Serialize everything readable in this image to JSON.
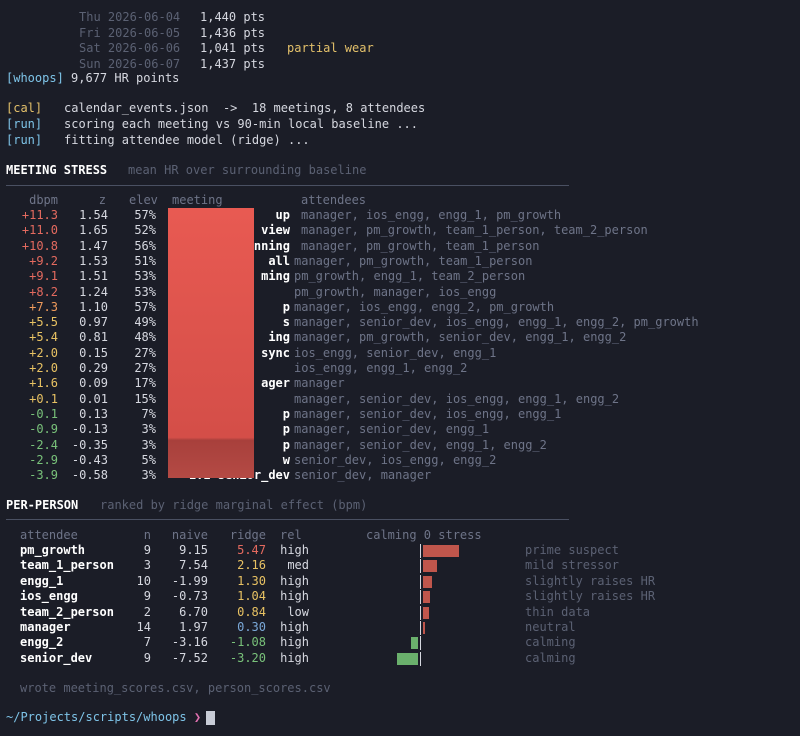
{
  "daily": [
    {
      "day": "Thu 2026-06-04",
      "pts": "1,440 pts",
      "note": ""
    },
    {
      "day": "Fri 2026-06-05",
      "pts": "1,436 pts",
      "note": ""
    },
    {
      "day": "Sat 2026-06-06",
      "pts": "1,041 pts",
      "note": "partial wear"
    },
    {
      "day": "Sun 2026-06-07",
      "pts": "1,437 pts",
      "note": ""
    }
  ],
  "whoops_tag": "[whoops]",
  "whoops_text": "9,677 HR points",
  "log": [
    {
      "tag": "[cal]",
      "text": "calendar_events.json  ->  18 meetings, 8 attendees"
    },
    {
      "tag": "[run]",
      "text": "scoring each meeting vs 90-min local baseline ..."
    },
    {
      "tag": "[run]",
      "text": "fitting attendee model (ridge) ..."
    }
  ],
  "meeting_title": "MEETING STRESS",
  "meeting_sub": "mean HR over surrounding baseline",
  "meeting_headers": {
    "dbpm": "dbpm",
    "z": "z",
    "elev": "elev",
    "meeting": "meeting",
    "attendees": "attendees"
  },
  "meetings": [
    {
      "dbpm": "+11.3",
      "z": "1.54",
      "elev": "57%",
      "name": "up",
      "att": "manager, ios_engg, engg_1, pm_growth",
      "c": "red"
    },
    {
      "dbpm": "+11.0",
      "z": "1.65",
      "elev": "52%",
      "name": "view",
      "att": "manager, pm_growth, team_1_person, team_2_person",
      "c": "red"
    },
    {
      "dbpm": "+10.8",
      "z": "1.47",
      "elev": "56%",
      "name": "nning",
      "att": "manager, pm_growth, team_1_person",
      "c": "red"
    },
    {
      "dbpm": "+9.2",
      "z": "1.53",
      "elev": "51%",
      "name": "all",
      "att": "manager, pm_growth, team_1_person",
      "c": "red"
    },
    {
      "dbpm": "+9.1",
      "z": "1.51",
      "elev": "53%",
      "name": "ming",
      "att": "pm_growth, engg_1, team_2_person",
      "c": "red"
    },
    {
      "dbpm": "+8.2",
      "z": "1.24",
      "elev": "53%",
      "name": "",
      "att": "pm_growth, manager, ios_engg",
      "c": "red"
    },
    {
      "dbpm": "+7.3",
      "z": "1.10",
      "elev": "57%",
      "name": "p",
      "att": "manager, ios_engg, engg_2, pm_growth",
      "c": "orange"
    },
    {
      "dbpm": "+5.5",
      "z": "0.97",
      "elev": "49%",
      "name": "s",
      "att": "manager, senior_dev, ios_engg, engg_1, engg_2, pm_growth",
      "c": "ylw"
    },
    {
      "dbpm": "+5.4",
      "z": "0.81",
      "elev": "48%",
      "name": "ing",
      "att": "manager, pm_growth, senior_dev, engg_1, engg_2",
      "c": "ylw"
    },
    {
      "dbpm": "+2.0",
      "z": "0.15",
      "elev": "27%",
      "name": "sync",
      "att": "ios_engg, senior_dev, engg_1",
      "c": "ylw"
    },
    {
      "dbpm": "+2.0",
      "z": "0.29",
      "elev": "27%",
      "name": "",
      "att": "ios_engg, engg_1, engg_2",
      "c": "ylw"
    },
    {
      "dbpm": "+1.6",
      "z": "0.09",
      "elev": "17%",
      "name": "ager",
      "att": "manager",
      "c": "ylw"
    },
    {
      "dbpm": "+0.1",
      "z": "0.01",
      "elev": "15%",
      "name": "",
      "att": "manager, senior_dev, ios_engg, engg_1, engg_2",
      "c": "ylw"
    },
    {
      "dbpm": "-0.1",
      "z": "0.13",
      "elev": "7%",
      "name": "p",
      "att": "manager, senior_dev, ios_engg, engg_1",
      "c": "green"
    },
    {
      "dbpm": "-0.9",
      "z": "-0.13",
      "elev": "3%",
      "name": "p",
      "att": "manager, senior_dev, engg_1",
      "c": "green"
    },
    {
      "dbpm": "-2.4",
      "z": "-0.35",
      "elev": "3%",
      "name": "p",
      "att": "manager, senior_dev, engg_1, engg_2",
      "c": "green"
    },
    {
      "dbpm": "-2.9",
      "z": "-0.43",
      "elev": "5%",
      "name": "w",
      "att": "senior_dev, ios_engg, engg_2",
      "c": "green"
    },
    {
      "dbpm": "-3.9",
      "z": "-0.58",
      "elev": "3%",
      "name": "1:1 senior_dev",
      "att": "senior_dev, manager",
      "c": "green"
    }
  ],
  "person_title": "PER-PERSON",
  "person_sub": "ranked by ridge marginal effect (bpm)",
  "person_headers": {
    "att": "attendee",
    "n": "n",
    "naive": "naive",
    "ridge": "ridge",
    "rel": "rel",
    "axis": "calming 0 stress"
  },
  "people": [
    {
      "name": "pm_growth",
      "n": "9",
      "naive": "9.15",
      "ridge": "5.47",
      "ridge_value": 5.47,
      "rel": "high",
      "verdict": "prime suspect",
      "c": "red"
    },
    {
      "name": "team_1_person",
      "n": "3",
      "naive": "7.54",
      "ridge": "2.16",
      "ridge_value": 2.16,
      "rel": "med",
      "verdict": "mild stressor",
      "c": "ylw"
    },
    {
      "name": "engg_1",
      "n": "10",
      "naive": "-1.99",
      "ridge": "1.30",
      "ridge_value": 1.3,
      "rel": "high",
      "verdict": "slightly raises HR",
      "c": "ylw"
    },
    {
      "name": "ios_engg",
      "n": "9",
      "naive": "-0.73",
      "ridge": "1.04",
      "ridge_value": 1.04,
      "rel": "high",
      "verdict": "slightly raises HR",
      "c": "ylw"
    },
    {
      "name": "team_2_person",
      "n": "2",
      "naive": "6.70",
      "ridge": "0.84",
      "ridge_value": 0.84,
      "rel": "low",
      "verdict": "thin data",
      "c": "ylw"
    },
    {
      "name": "manager",
      "n": "14",
      "naive": "1.97",
      "ridge": "0.30",
      "ridge_value": 0.3,
      "rel": "high",
      "verdict": "neutral",
      "c": "blue"
    },
    {
      "name": "engg_2",
      "n": "7",
      "naive": "-3.16",
      "ridge": "-1.08",
      "ridge_value": -1.08,
      "rel": "high",
      "verdict": "calming",
      "c": "green"
    },
    {
      "name": "senior_dev",
      "n": "9",
      "naive": "-7.52",
      "ridge": "-3.20",
      "ridge_value": -3.2,
      "rel": "high",
      "verdict": "calming",
      "c": "green"
    }
  ],
  "footer": "wrote meeting_scores.csv, person_scores.csv",
  "prompt_path": "~/Projects/scripts/whoops",
  "prompt_symbol": "❯",
  "colors": {
    "bar_pos": "#c0564c",
    "bar_neg": "#6ab06c",
    "axis": "#d6d8e0"
  }
}
